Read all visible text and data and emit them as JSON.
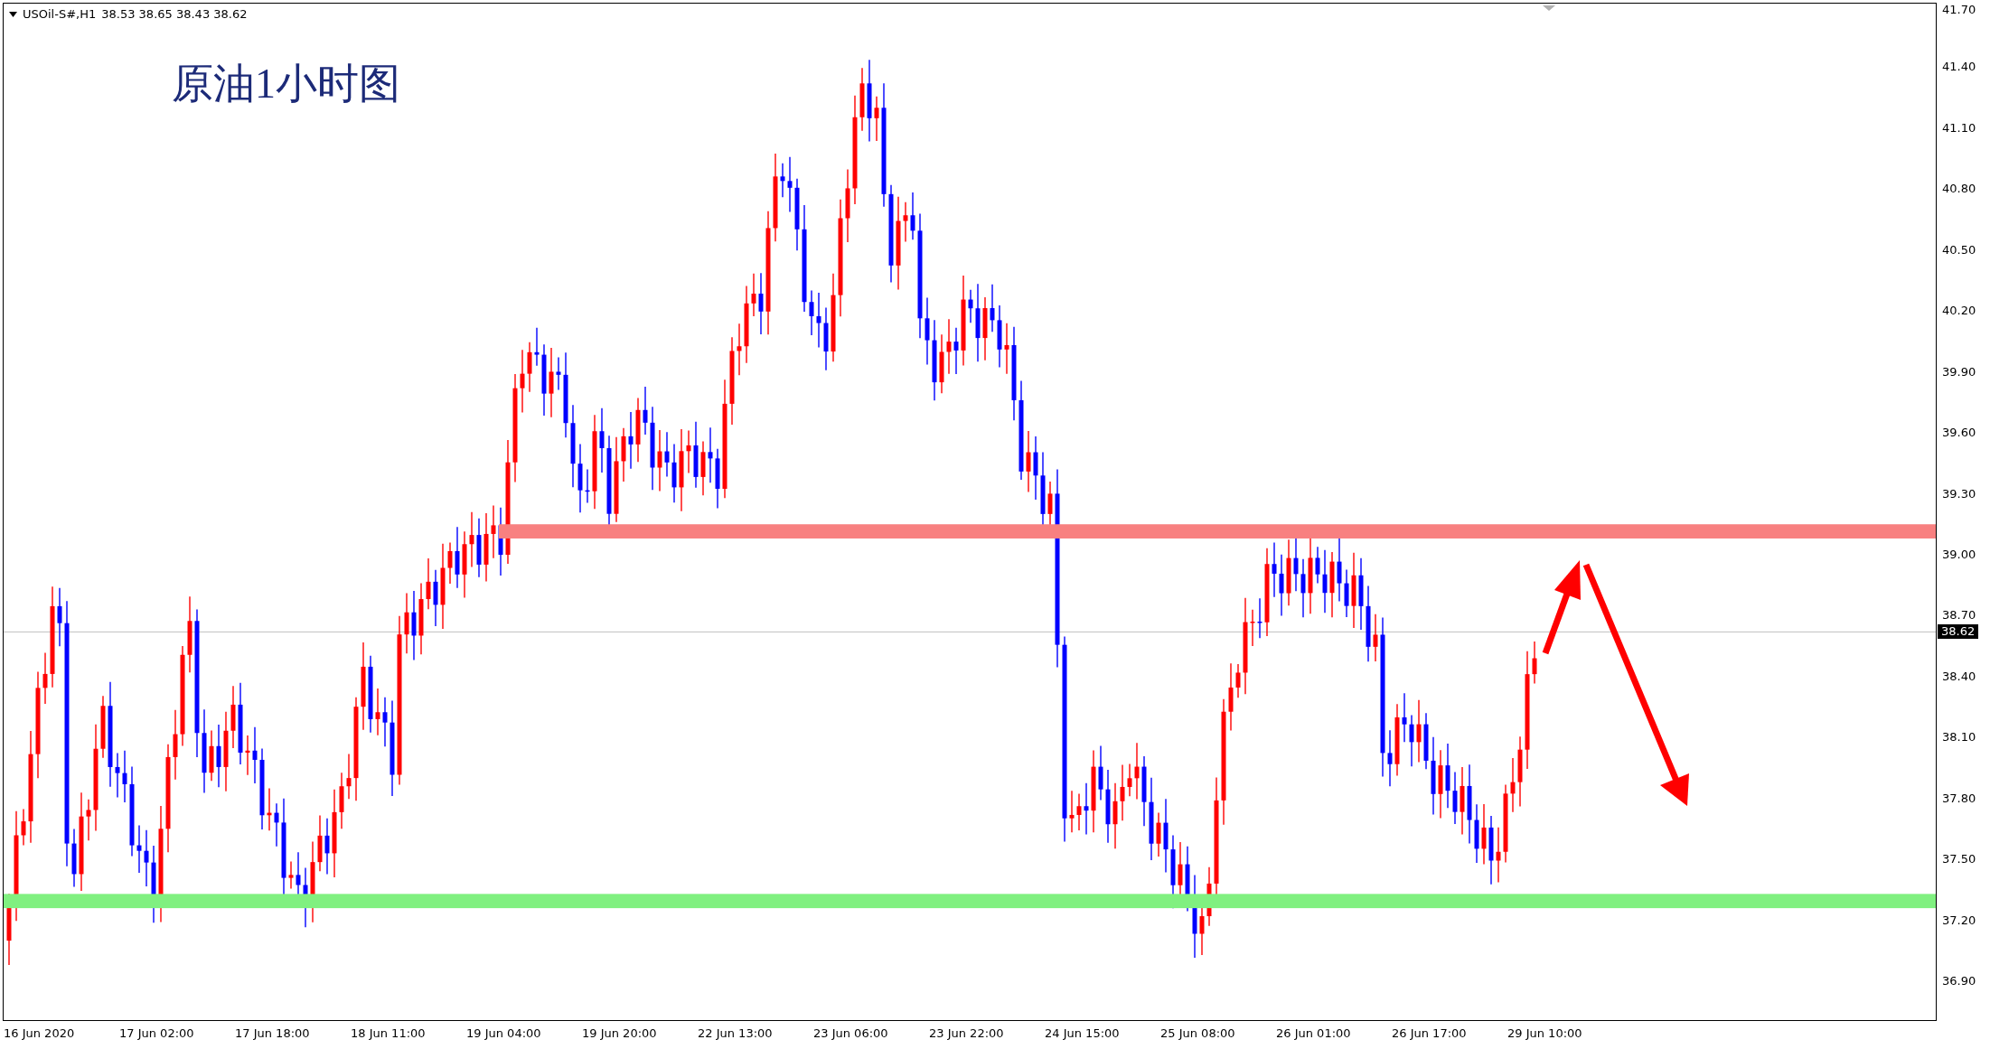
{
  "header": {
    "symbol": "USOil-S#,H1",
    "quote": "38.53 38.65 38.43 38.62"
  },
  "title": "原油1小时图",
  "price_axis": {
    "ticks": [
      "41.70",
      "41.40",
      "41.10",
      "40.80",
      "40.50",
      "40.20",
      "39.90",
      "39.60",
      "39.30",
      "39.00",
      "38.70",
      "38.40",
      "38.10",
      "37.80",
      "37.50",
      "37.20",
      "36.90"
    ],
    "current": "38.62"
  },
  "time_axis": [
    "16 Jun 2020",
    "17 Jun 02:00",
    "17 Jun 18:00",
    "18 Jun 11:00",
    "19 Jun 04:00",
    "19 Jun 20:00",
    "22 Jun 13:00",
    "23 Jun 06:00",
    "23 Jun 22:00",
    "24 Jun 15:00",
    "25 Jun 08:00",
    "26 Jun 01:00",
    "26 Jun 17:00",
    "29 Jun 10:00"
  ]
}
